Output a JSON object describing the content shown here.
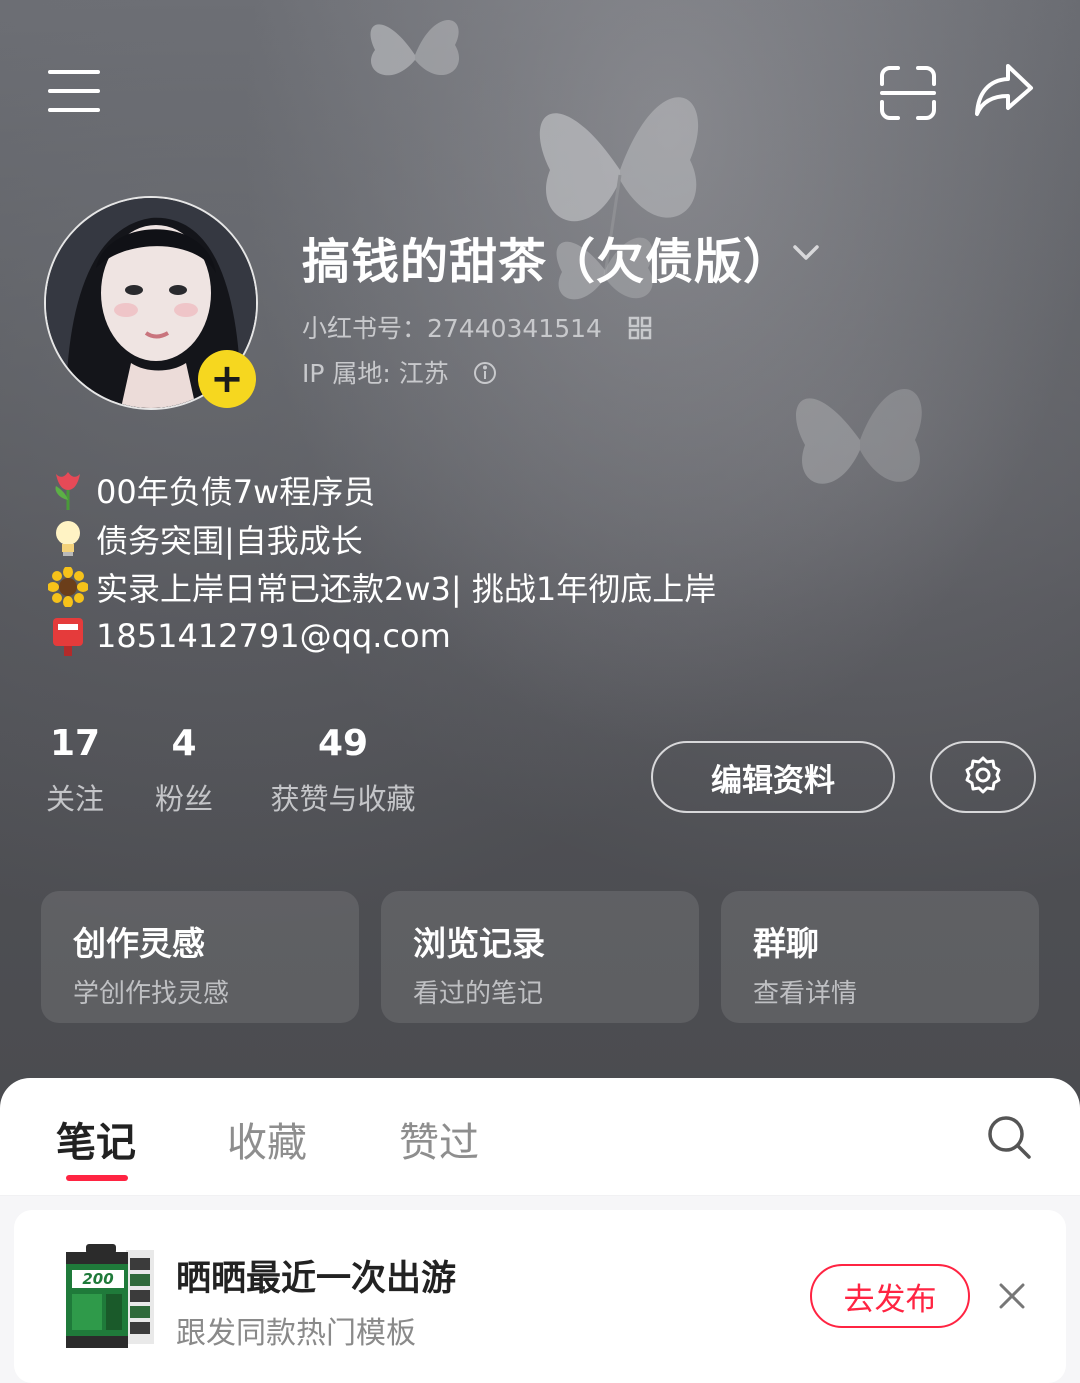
{
  "colors": {
    "accent": "#ff2442",
    "badge": "#f6d71f",
    "hero_bg": "#55575c",
    "text_primary": "#ffffff",
    "text_secondary": "#c4c5c8"
  },
  "header": {
    "menu_icon": "menu-icon",
    "scan_icon": "scan-icon",
    "share_icon": "share-icon"
  },
  "profile": {
    "name": "搞钱的甜茶（欠债版）",
    "id_text": "小红书号：27440341514",
    "ip_text": "IP 属地: 江苏",
    "add_badge": "+"
  },
  "bio": [
    {
      "emoji": "tulip",
      "text": "00年负债7w程序员"
    },
    {
      "emoji": "bulb",
      "text": "债务突围|自我成长"
    },
    {
      "emoji": "sunflower",
      "text": "实录上岸日常已还款2w3| 挑战1年彻底上岸"
    },
    {
      "emoji": "postbox",
      "text": "1851412791@qq.com"
    }
  ],
  "stats": [
    {
      "value": "17",
      "label": "关注"
    },
    {
      "value": "4",
      "label": "粉丝"
    },
    {
      "value": "49",
      "label": "获赞与收藏"
    }
  ],
  "actions": {
    "edit_label": "编辑资料",
    "settings_icon": "gear-icon"
  },
  "cards": [
    {
      "title": "创作灵感",
      "subtitle": "学创作找灵感"
    },
    {
      "title": "浏览记录",
      "subtitle": "看过的笔记"
    },
    {
      "title": "群聊",
      "subtitle": "查看详情"
    }
  ],
  "tabs": [
    {
      "label": "笔记",
      "active": true
    },
    {
      "label": "收藏",
      "active": false
    },
    {
      "label": "赞过",
      "active": false
    }
  ],
  "promo": {
    "title": "晒晒最近一次出游",
    "subtitle": "跟发同款热门模板",
    "button": "去发布",
    "film_label": "200"
  }
}
